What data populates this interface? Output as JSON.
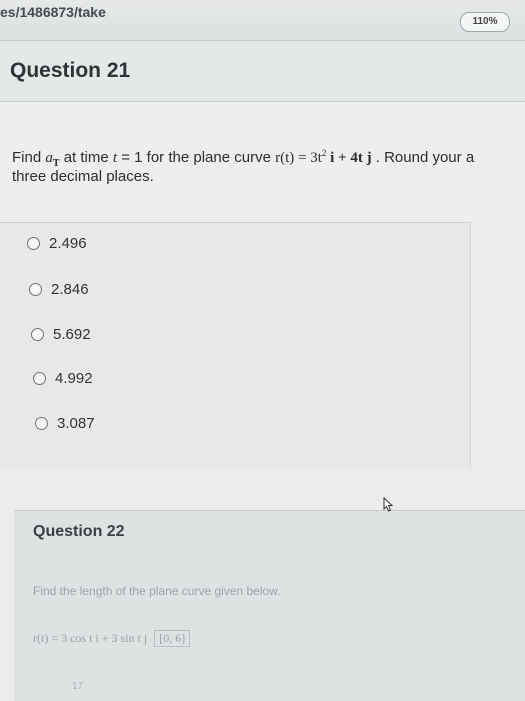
{
  "browser": {
    "url_fragment": "es/1486873/take",
    "zoom": "110%"
  },
  "question21": {
    "title": "Question 21",
    "prompt_find": "Find",
    "prompt_symbol": "a",
    "prompt_subscript": "T",
    "prompt_mid": " at time ",
    "prompt_t": "t",
    "prompt_eq": " = 1 for the plane curve ",
    "prompt_curve": "r(t) = 3t",
    "prompt_exp": "2",
    "prompt_curve_rest": " i + 4t j",
    "prompt_tail": ". Round your a",
    "prompt_line2": "three decimal places.",
    "options": [
      "2.496",
      "2.846",
      "5.692",
      "4.992",
      "3.087"
    ]
  },
  "question22": {
    "title": "Question 22",
    "prompt": "Find the length of the plane curve given below.",
    "formula": "r(t) = 3 cos t i + 3 sin t j",
    "interval": "[0, 6]"
  },
  "footer": {
    "page_number": "17"
  },
  "colors": {
    "background": "#ecedeb",
    "header": "#e5e8e8",
    "text": "#2d2f30"
  }
}
